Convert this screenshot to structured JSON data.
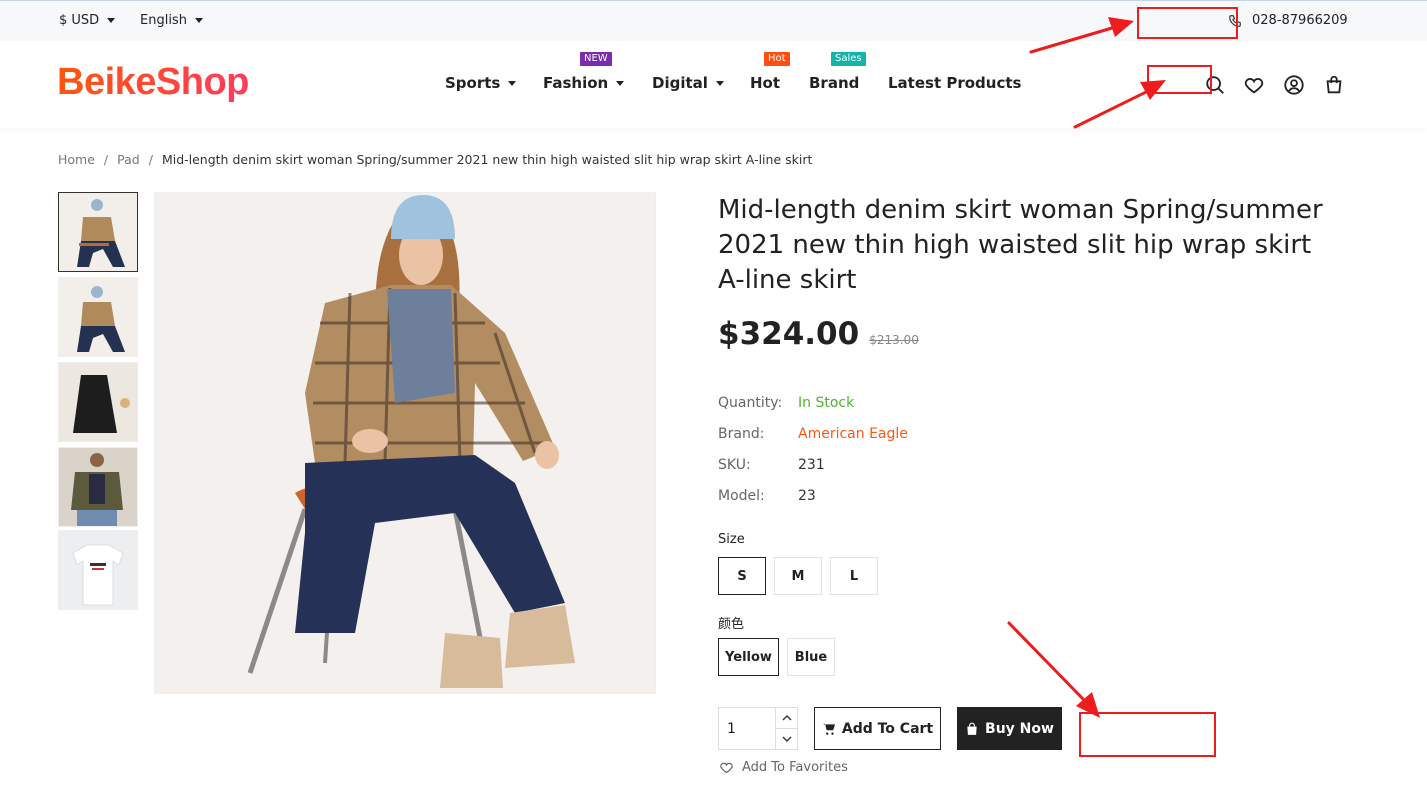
{
  "topbar": {
    "currency": "$ USD",
    "language": "English",
    "phone": "028-87966209"
  },
  "header": {
    "logo": "BeikeShop",
    "nav": [
      {
        "label": "Sports",
        "has_dropdown": true,
        "badge": ""
      },
      {
        "label": "Fashion",
        "has_dropdown": true,
        "badge": "NEW",
        "badge_color": "#7b2cae"
      },
      {
        "label": "Digital",
        "has_dropdown": true,
        "badge": ""
      },
      {
        "label": "Hot",
        "has_dropdown": false,
        "badge": "Hot",
        "badge_color": "#ff4e11"
      },
      {
        "label": "Brand",
        "has_dropdown": false,
        "badge": "Sales",
        "badge_color": "#13b5a9"
      },
      {
        "label": "Latest Products",
        "has_dropdown": false,
        "badge": ""
      }
    ],
    "icons": [
      "search-icon",
      "heart-icon",
      "user-icon",
      "cart-icon"
    ]
  },
  "breadcrumb": {
    "items": [
      "Home",
      "Pad"
    ],
    "current": "Mid-length denim skirt woman Spring/summer 2021 new thin high waisted slit hip wrap skirt A-line skirt"
  },
  "product": {
    "title": "Mid-length denim skirt woman Spring/summer 2021 new thin high waisted slit hip wrap skirt A-line skirt",
    "price": "$324.00",
    "old_price": "$213.00",
    "attributes": [
      {
        "label": "Quantity:",
        "value": "In Stock",
        "color": "#4fb232"
      },
      {
        "label": "Brand:",
        "value": "American Eagle",
        "color": "#fd560f"
      },
      {
        "label": "SKU:",
        "value": "231",
        "color": "#333333"
      },
      {
        "label": "Model:",
        "value": "23",
        "color": "#333333"
      }
    ],
    "size_label": "Size",
    "sizes": [
      "S",
      "M",
      "L"
    ],
    "selected_size": "S",
    "color_label": "颜色",
    "colors": [
      "Yellow",
      "Blue"
    ],
    "selected_color": "Yellow",
    "quantity": "1",
    "add_to_cart": "Add To Cart",
    "buy_now": "Buy Now",
    "favorites": "Add To Favorites"
  },
  "colors": {
    "brand": "#fd560f",
    "annotation": "#ee1c1c"
  }
}
